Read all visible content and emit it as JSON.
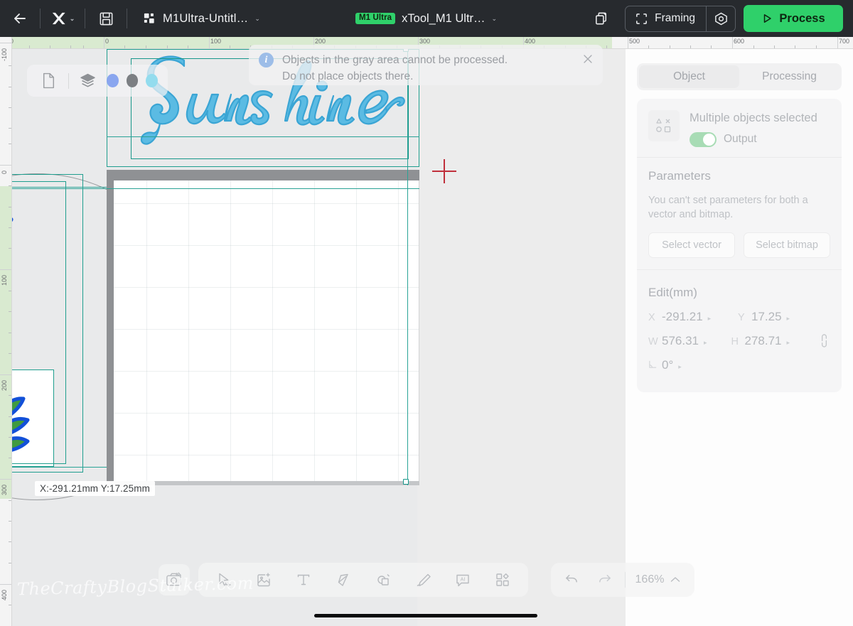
{
  "topbar": {
    "back_icon": "arrow-left-icon",
    "brand_icon": "xtool-x-logo",
    "brand_caret": "⌄",
    "save_icon": "floppy-save-icon",
    "project_icon": "grid-blocks-icon",
    "project_name": "M1Ultra-Untitl…",
    "project_caret": "⌄",
    "device_badge": "M1 Ultra",
    "device_name": "xTool_M1 Ultr…",
    "device_caret": "⌄",
    "copy_icon": "duplicate-layers-icon",
    "framing_label": "Framing",
    "framing_icon": "framing-brackets-icon",
    "target_icon": "target-locate-icon",
    "process_label": "Process",
    "process_icon": "play-triangle-icon",
    "accent_green": "#2fd06a",
    "bar_background": "#272a2e"
  },
  "notice": {
    "icon": "info-circle-icon",
    "line1": "Objects in the gray area cannot be processed.",
    "line2": "Do not place objects there.",
    "close_icon": "close-x-icon"
  },
  "left_panel": {
    "file_icon": "file-page-icon",
    "layers_icon": "layers-stack-icon",
    "swatches": [
      {
        "name": "color-swatch-blue",
        "color": "#8aa6ef"
      },
      {
        "name": "color-swatch-gray",
        "color": "#7c7f83"
      },
      {
        "name": "color-swatch-cyan",
        "color": "#93dcee"
      }
    ]
  },
  "rulers": {
    "horizontal_labels": [
      "0",
      "0",
      "100",
      "200",
      "300",
      "400",
      "500",
      "600",
      "700"
    ],
    "vertical_labels": [
      "-100",
      "0",
      "100",
      "200",
      "300",
      "400"
    ],
    "unit": "mm"
  },
  "canvas": {
    "artwork_text": "Sunshine",
    "artwork_fill": "#5bbbe3",
    "artwork_stroke": "#3ba5d4",
    "selection_color": "#1f9e8e",
    "crosshair_color": "#c0303c",
    "coord_tooltip": "X:-291.21mm Y:17.25mm",
    "leaf_green": "#3f9b40",
    "leaf_blue": "#1250d8",
    "arc_blue": "#1250d8"
  },
  "right_panel": {
    "tabs": [
      {
        "label": "Object",
        "active": true
      },
      {
        "label": "Processing",
        "active": false
      }
    ],
    "object": {
      "thumb_icon": "multi-shapes-icon",
      "title": "Multiple objects selected",
      "toggle_label": "Output",
      "toggle_on": true,
      "toggle_color": "#a8dcb5"
    },
    "parameters": {
      "title": "Parameters",
      "hint": "You can't set parameters for both a vector and bitmap.",
      "select_vector_label": "Select vector",
      "select_bitmap_label": "Select bitmap"
    },
    "edit": {
      "title": "Edit(mm)",
      "fields": [
        {
          "key": "X",
          "value": "-291.21",
          "arrow": "▸"
        },
        {
          "key": "Y",
          "value": "17.25",
          "arrow": "▸"
        },
        {
          "key": "W",
          "value": "576.31",
          "arrow": "▸"
        },
        {
          "key": "H",
          "value": "278.71",
          "arrow": "▸"
        }
      ],
      "rotation": {
        "key": "rotate-icon",
        "value": "0°",
        "arrow": "▸"
      },
      "link_icon": "chain-link-icon"
    }
  },
  "bottombar": {
    "camera_icon": "camera-capture-icon",
    "tools": [
      {
        "name": "select-tool-icon",
        "label": "Select"
      },
      {
        "name": "insert-image-icon",
        "label": "Image"
      },
      {
        "name": "text-tool-icon",
        "label": "Text"
      },
      {
        "name": "pen-path-tool-icon",
        "label": "Path"
      },
      {
        "name": "shapes-tool-icon",
        "label": "Shapes"
      },
      {
        "name": "draw-pencil-icon",
        "label": "Draw"
      },
      {
        "name": "ai-panel-icon",
        "label": "AI"
      },
      {
        "name": "elements-grid-icon",
        "label": "Elements"
      }
    ],
    "undo_icon": "undo-arrow-icon",
    "redo_icon": "redo-arrow-icon",
    "zoom_level": "166%",
    "zoom_caret": "⌃"
  },
  "watermark": {
    "text": "TheCraftyBlogStalker.com"
  }
}
